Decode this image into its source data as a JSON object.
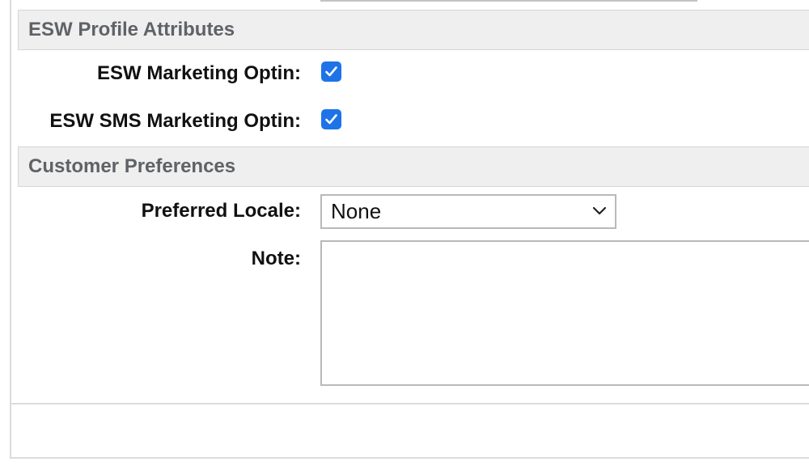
{
  "sections": {
    "esw_profile": {
      "title": "ESW Profile Attributes",
      "marketing_optin_label": "ESW Marketing Optin:",
      "marketing_optin_checked": true,
      "sms_marketing_optin_label": "ESW SMS Marketing Optin:",
      "sms_marketing_optin_checked": true
    },
    "customer_preferences": {
      "title": "Customer Preferences",
      "preferred_locale_label": "Preferred Locale:",
      "preferred_locale_value": "None",
      "note_label": "Note:",
      "note_value": ""
    }
  },
  "colors": {
    "checkbox_accent": "#1e73e8",
    "section_header_bg": "#efefef",
    "section_header_text": "#5f6266"
  },
  "icons": {
    "checkbox": "checkmark-icon",
    "select": "chevron-down-icon"
  }
}
